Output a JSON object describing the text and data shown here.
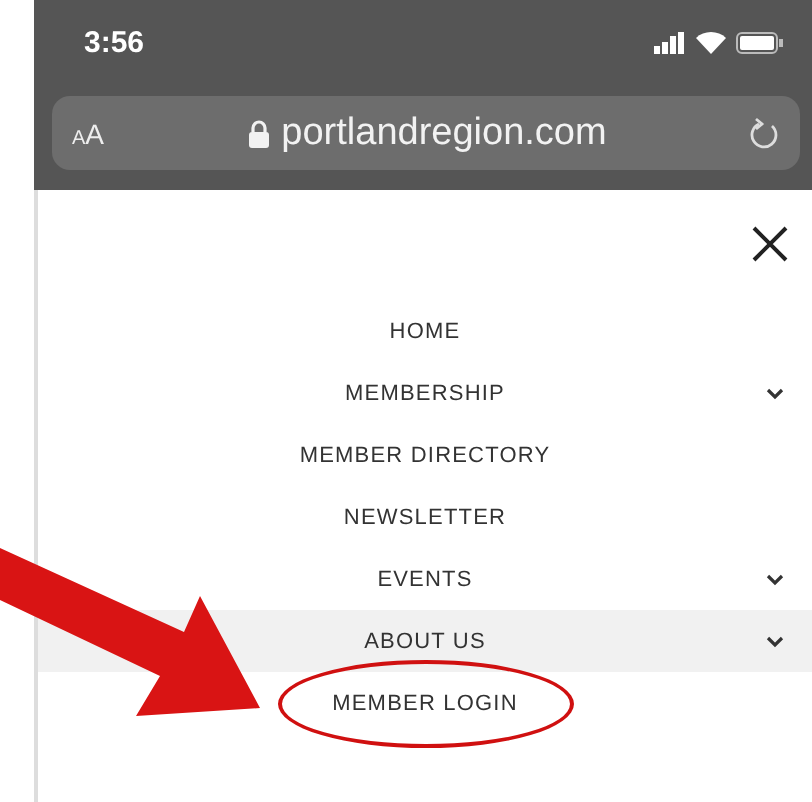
{
  "status_bar": {
    "time": "3:56"
  },
  "address_bar": {
    "text_size": "AA",
    "url": "portlandregion.com"
  },
  "menu": {
    "items": [
      {
        "label": "HOME",
        "expandable": false,
        "highlighted": false,
        "circled": false
      },
      {
        "label": "MEMBERSHIP",
        "expandable": true,
        "highlighted": false,
        "circled": false
      },
      {
        "label": "MEMBER DIRECTORY",
        "expandable": false,
        "highlighted": false,
        "circled": false
      },
      {
        "label": "NEWSLETTER",
        "expandable": false,
        "highlighted": false,
        "circled": false
      },
      {
        "label": "EVENTS",
        "expandable": true,
        "highlighted": false,
        "circled": false
      },
      {
        "label": "ABOUT US",
        "expandable": true,
        "highlighted": true,
        "circled": false
      },
      {
        "label": "MEMBER LOGIN",
        "expandable": false,
        "highlighted": false,
        "circled": true
      }
    ]
  }
}
